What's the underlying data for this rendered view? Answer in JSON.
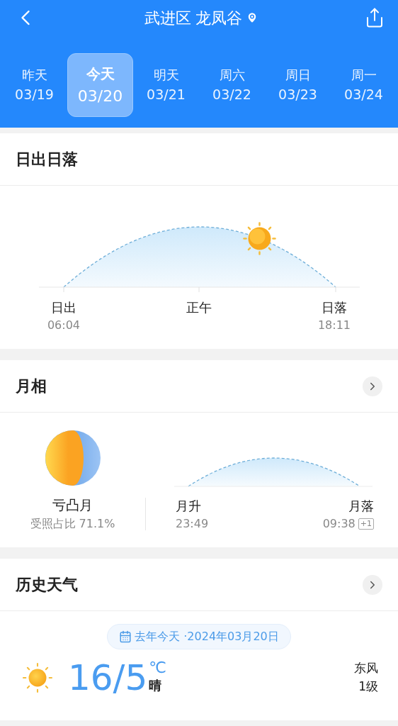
{
  "header": {
    "title": "武进区 龙凤谷"
  },
  "days": [
    {
      "label": "昨天",
      "date": "03/19",
      "selected": false
    },
    {
      "label": "今天",
      "date": "03/20",
      "selected": true
    },
    {
      "label": "明天",
      "date": "03/21",
      "selected": false
    },
    {
      "label": "周六",
      "date": "03/22",
      "selected": false
    },
    {
      "label": "周日",
      "date": "03/23",
      "selected": false
    },
    {
      "label": "周一",
      "date": "03/24",
      "selected": false
    }
  ],
  "sun": {
    "title": "日出日落",
    "level": 0.72,
    "labels": [
      {
        "name": "日出",
        "time": "06:04"
      },
      {
        "name": "正午"
      },
      {
        "name": "日落",
        "time": "18:11"
      }
    ]
  },
  "moon": {
    "title": "月相",
    "phase": "亏凸月",
    "illumination": "受照占比 71.1%",
    "rise": {
      "name": "月升",
      "time": "23:49"
    },
    "set": {
      "name": "月落",
      "time": "09:38",
      "badge": "+1"
    }
  },
  "history": {
    "title": "历史天气",
    "date_label": "去年今天 ·2024年03月20日",
    "temp": "16/5",
    "unit": "℃",
    "condition": "晴",
    "wind": "东风",
    "wind_level": "1级"
  }
}
